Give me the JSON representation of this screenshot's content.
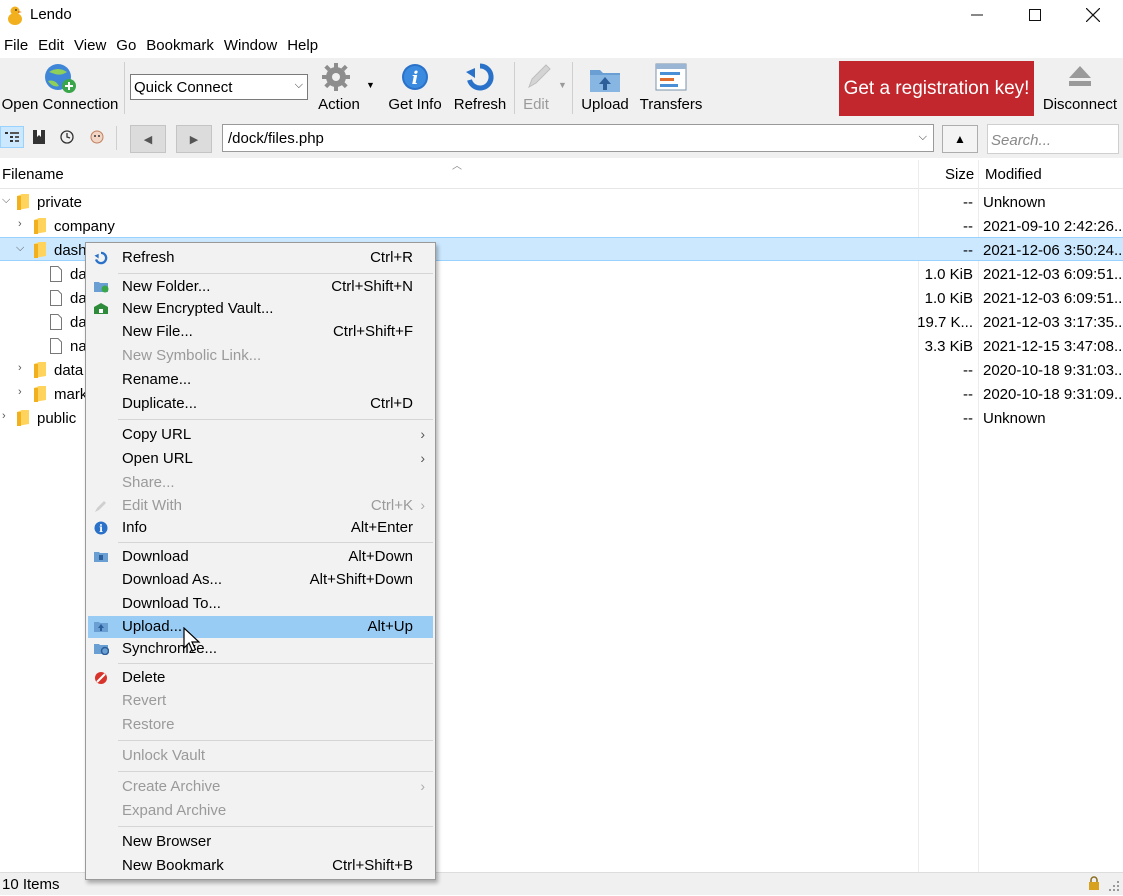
{
  "window": {
    "title": "Lendo"
  },
  "menubar": [
    "File",
    "Edit",
    "View",
    "Go",
    "Bookmark",
    "Window",
    "Help"
  ],
  "toolbar": {
    "open_connection": "Open Connection",
    "quick_connect": "Quick Connect",
    "action": "Action",
    "get_info": "Get Info",
    "refresh": "Refresh",
    "edit": "Edit",
    "upload": "Upload",
    "transfers": "Transfers",
    "registration": "Get a registration key!",
    "disconnect": "Disconnect"
  },
  "pathbar": {
    "path": "/dock/files.php",
    "search_placeholder": "Search..."
  },
  "table": {
    "headers": {
      "filename": "Filename",
      "size": "Size",
      "modified": "Modified"
    },
    "rows": [
      {
        "name": "private",
        "size": "--",
        "modified": "Unknown"
      },
      {
        "name": "company",
        "size": "--",
        "modified": "2021-09-10 2:42:26..."
      },
      {
        "name": "dash",
        "size": "--",
        "modified": "2021-12-06 3:50:24..."
      },
      {
        "name": "da",
        "size": "1.0 KiB",
        "modified": "2021-12-03 6:09:51..."
      },
      {
        "name": "da",
        "size": "1.0 KiB",
        "modified": "2021-12-03 6:09:51..."
      },
      {
        "name": "da",
        "size": "19.7 K...",
        "modified": "2021-12-03 3:17:35..."
      },
      {
        "name": "na",
        "size": "3.3 KiB",
        "modified": "2021-12-15 3:47:08..."
      },
      {
        "name": "data",
        "size": "--",
        "modified": "2020-10-18 9:31:03..."
      },
      {
        "name": "mark",
        "size": "--",
        "modified": "2020-10-18 9:31:09..."
      },
      {
        "name": "public",
        "size": "--",
        "modified": "Unknown"
      }
    ]
  },
  "context_menu": {
    "items": [
      {
        "label": "Refresh",
        "shortcut": "Ctrl+R"
      },
      {
        "label": "New Folder...",
        "shortcut": "Ctrl+Shift+N"
      },
      {
        "label": "New Encrypted Vault...",
        "shortcut": ""
      },
      {
        "label": "New File...",
        "shortcut": "Ctrl+Shift+F"
      },
      {
        "label": "New Symbolic Link...",
        "shortcut": ""
      },
      {
        "label": "Rename...",
        "shortcut": ""
      },
      {
        "label": "Duplicate...",
        "shortcut": "Ctrl+D"
      },
      {
        "label": "Copy URL",
        "shortcut": ""
      },
      {
        "label": "Open URL",
        "shortcut": ""
      },
      {
        "label": "Share...",
        "shortcut": ""
      },
      {
        "label": "Edit With",
        "shortcut": "Ctrl+K"
      },
      {
        "label": "Info",
        "shortcut": "Alt+Enter"
      },
      {
        "label": "Download",
        "shortcut": "Alt+Down"
      },
      {
        "label": "Download As...",
        "shortcut": "Alt+Shift+Down"
      },
      {
        "label": "Download To...",
        "shortcut": ""
      },
      {
        "label": "Upload...",
        "shortcut": "Alt+Up"
      },
      {
        "label": "Synchronize...",
        "shortcut": ""
      },
      {
        "label": "Delete",
        "shortcut": ""
      },
      {
        "label": "Revert",
        "shortcut": ""
      },
      {
        "label": "Restore",
        "shortcut": ""
      },
      {
        "label": "Unlock Vault",
        "shortcut": ""
      },
      {
        "label": "Create Archive",
        "shortcut": ""
      },
      {
        "label": "Expand Archive",
        "shortcut": ""
      },
      {
        "label": "New Browser",
        "shortcut": ""
      },
      {
        "label": "New Bookmark",
        "shortcut": "Ctrl+Shift+B"
      }
    ]
  },
  "status": {
    "text": "10 Items"
  },
  "colors": {
    "registration_bg": "#c1272d",
    "selection": "#cce8ff",
    "menu_highlight": "#99ccf5"
  }
}
